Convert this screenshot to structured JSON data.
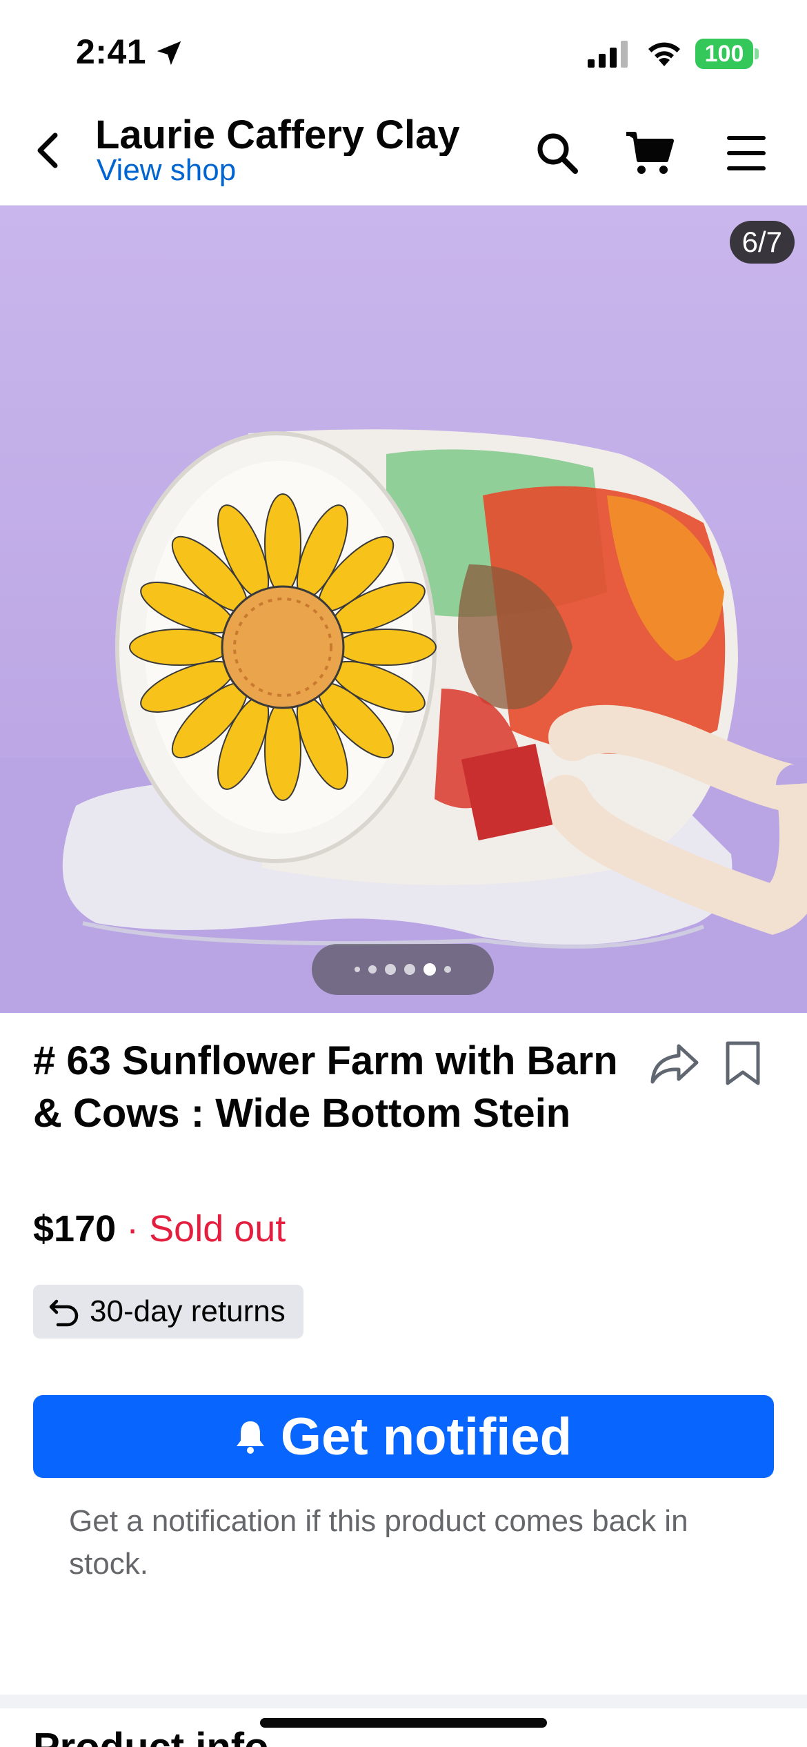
{
  "status_bar": {
    "time": "2:41",
    "battery": "100",
    "icons": [
      "location-arrow-icon",
      "signal-icon",
      "wifi-icon",
      "battery-icon"
    ]
  },
  "nav": {
    "shop_name": "Laurie Caffery Clay",
    "view_shop_label": "View shop",
    "icons": [
      "back-chevron-icon",
      "search-icon",
      "cart-icon",
      "menu-icon"
    ]
  },
  "gallery": {
    "counter": "6/7",
    "current_index": 6,
    "total": 7,
    "image_description_icons": [
      "mug-photo"
    ]
  },
  "product": {
    "title": "# 63 Sunflower Farm with Barn & Cows : Wide Bottom Stein",
    "price": "$170",
    "separator": " · ",
    "availability": "Sold out",
    "returns_label": "30-day returns",
    "notify_button_label": "Get notified",
    "notify_help_text": "Get a notification if this product comes back in stock."
  },
  "next_section": {
    "heading": "Product info"
  },
  "colors": {
    "accent_blue": "#0866ff",
    "link_blue": "#0064d1",
    "sold_out_red": "#e41e3f",
    "chip_gray": "#e4e6eb",
    "secondary_text": "#65676b",
    "battery_green": "#34c759"
  }
}
